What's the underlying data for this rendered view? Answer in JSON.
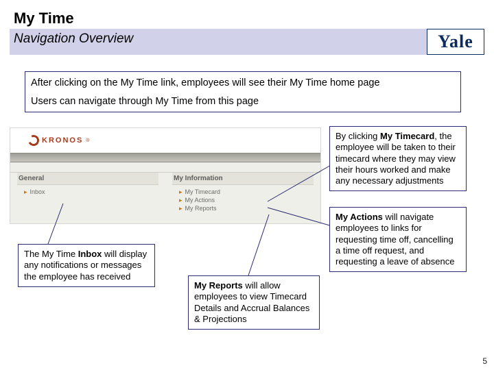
{
  "header": {
    "title": "My Time",
    "subtitle": "Navigation Overview",
    "brand": "Yale"
  },
  "intro": {
    "line1": "After clicking on the My Time link, employees will see their My Time home page",
    "line2": "Users can navigate through My Time from this page"
  },
  "kronos": {
    "brand": "KRONOS",
    "general": {
      "heading": "General",
      "items": [
        "Inbox"
      ]
    },
    "myinfo": {
      "heading": "My Information",
      "items": [
        "My Timecard",
        "My Actions",
        "My Reports"
      ]
    }
  },
  "callouts": {
    "timecard_pre": "By clicking ",
    "timecard_bold": "My Timecard",
    "timecard_post": ", the employee will be taken to their timecard where they may view their hours worked and make any necessary adjustments",
    "actions_bold": "My Actions",
    "actions_post": " will navigate employees to links for requesting time off, cancelling a time off request, and requesting a leave of absence",
    "inbox_pre": "The My Time ",
    "inbox_bold": "Inbox",
    "inbox_post": " will display any notifications or messages the employee has received",
    "reports_bold": "My Reports",
    "reports_post": " will allow employees to view Timecard Details and Accrual Balances & Projections"
  },
  "pagenum": "5"
}
